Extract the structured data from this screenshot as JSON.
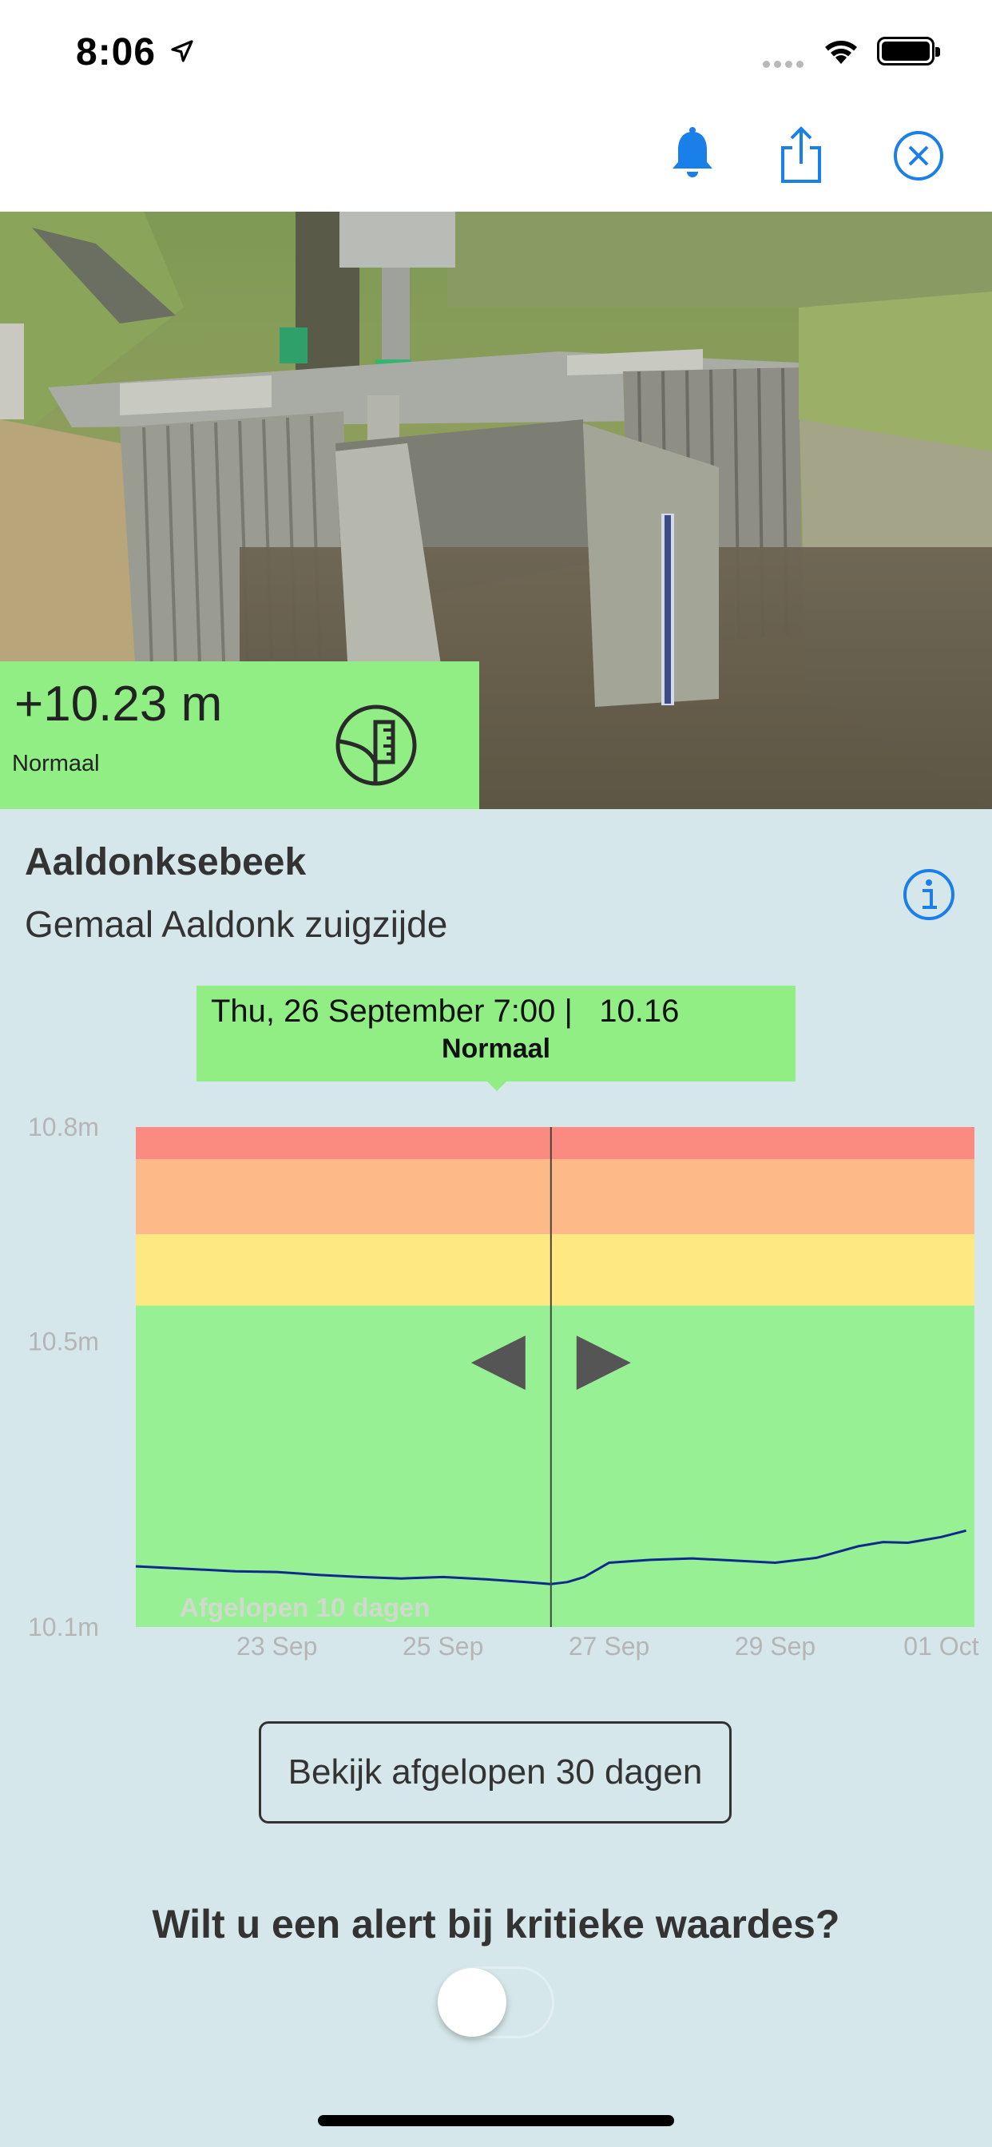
{
  "status_bar": {
    "time": "8:06",
    "icons": [
      "location-arrow-icon",
      "signal-dots-icon",
      "wifi-icon",
      "battery-icon"
    ]
  },
  "nav": {
    "icons": [
      "bell-icon",
      "share-icon",
      "close-circle-icon"
    ],
    "accent_color": "#1a7fe8"
  },
  "level": {
    "value": "+10.23 m",
    "status": "Normaal",
    "status_color": "#90ee84",
    "icon": "water-gauge-icon"
  },
  "location": {
    "river": "Aaldonksebeek",
    "station": "Gemaal Aaldonk zuigzijde",
    "info_icon": "info-icon"
  },
  "tooltip": {
    "datetime_value": "Thu, 26 September 7:00 |   10.16",
    "status": "Normaal"
  },
  "chart_data": {
    "type": "line",
    "y_unit": "m",
    "ylim": [
      10.1,
      10.8
    ],
    "ytick_labels": [
      "10.8m",
      "10.5m",
      "10.1m"
    ],
    "yticks": [
      10.8,
      10.5,
      10.1
    ],
    "xtick_labels": [
      "23 Sep",
      "25 Sep",
      "27 Sep",
      "29 Sep",
      "01 Oct"
    ],
    "xlim_days": [
      21.3,
      31.4
    ],
    "watermark": "Afgelopen 10 dagen",
    "bands": [
      {
        "from": 10.1,
        "to": 10.55,
        "color": "#98f094"
      },
      {
        "from": 10.55,
        "to": 10.65,
        "color": "#fde881"
      },
      {
        "from": 10.65,
        "to": 10.755,
        "color": "#fdba88"
      },
      {
        "from": 10.755,
        "to": 10.8,
        "color": "#fb8a80"
      }
    ],
    "selected_x": 26.3,
    "series": [
      {
        "line_color": "#0d2a8c",
        "x": [
          21.3,
          22.0,
          22.5,
          23.0,
          23.5,
          24.0,
          24.5,
          25.0,
          25.5,
          26.0,
          26.3,
          26.5,
          26.7,
          27.0,
          27.5,
          28.0,
          28.5,
          29.0,
          29.5,
          30.0,
          30.3,
          30.6,
          31.0,
          31.3
        ],
        "values": [
          10.185,
          10.181,
          10.178,
          10.177,
          10.173,
          10.17,
          10.168,
          10.17,
          10.167,
          10.163,
          10.16,
          10.163,
          10.17,
          10.19,
          10.194,
          10.196,
          10.193,
          10.19,
          10.197,
          10.213,
          10.219,
          10.218,
          10.226,
          10.235
        ]
      }
    ]
  },
  "actions": {
    "more_history_label": "Bekijk afgelopen 30 dagen",
    "alert_question": "Wilt u een alert bij kritieke waardes?",
    "alert_enabled": false
  }
}
